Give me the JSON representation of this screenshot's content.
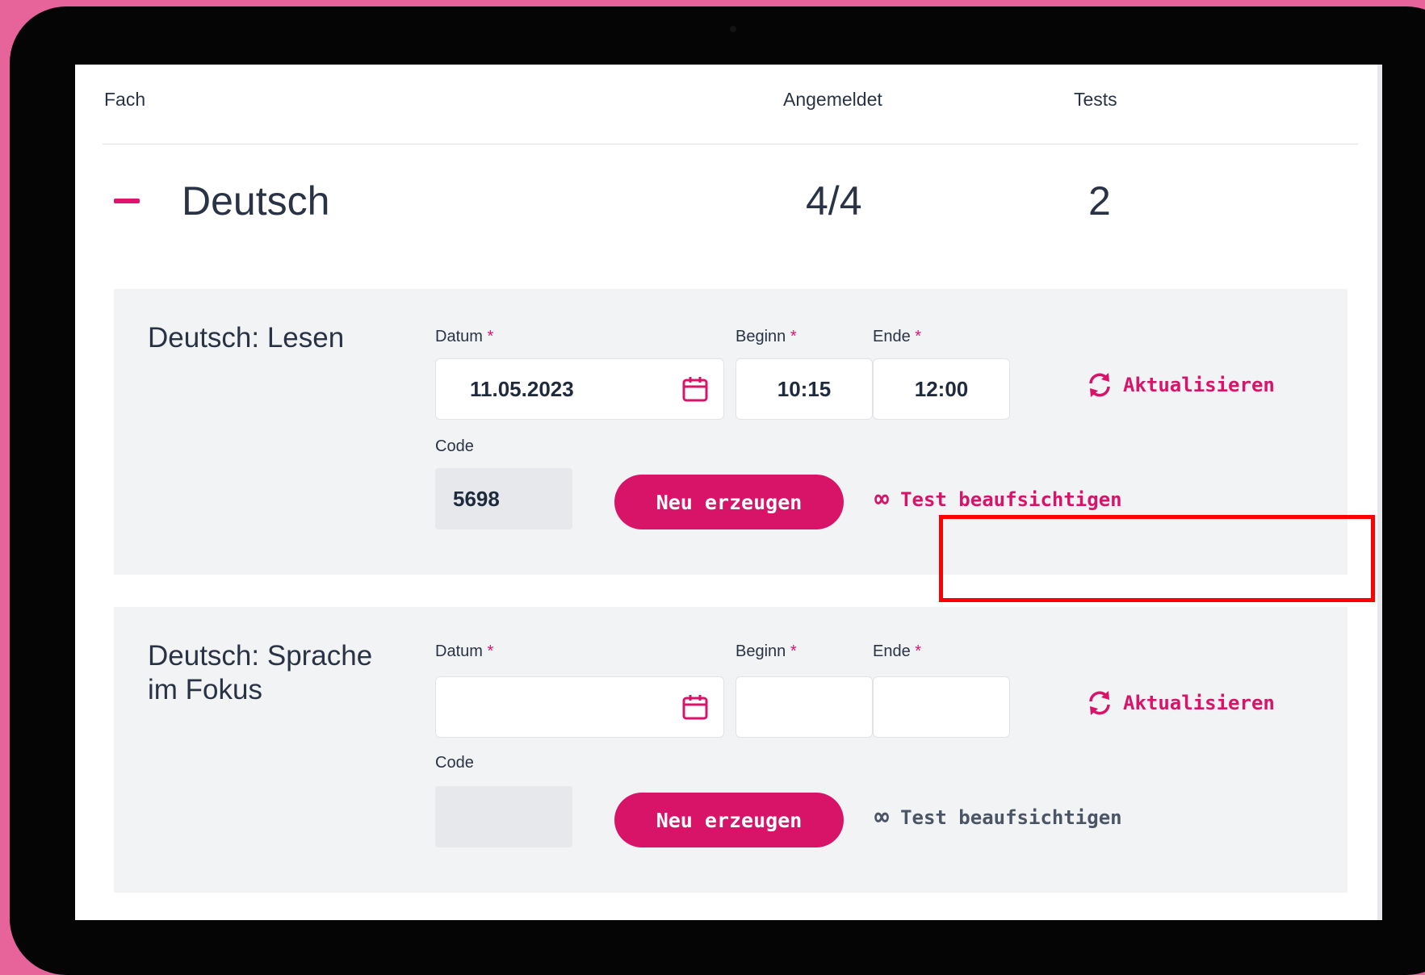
{
  "table_header": {
    "fach": "Fach",
    "angemeldet": "Angemeldet",
    "tests": "Tests"
  },
  "subject": {
    "name": "Deutsch",
    "registered": "4/4",
    "tests": "2"
  },
  "colors": {
    "accent": "#d81469",
    "background": "#e6649a",
    "highlight": "#ff0000"
  },
  "labels": {
    "datum": "Datum",
    "beginn": "Beginn",
    "ende": "Ende",
    "code": "Code",
    "required_mark": "*",
    "update": "Aktualisieren",
    "regenerate": "Neu erzeugen",
    "proctor": "Test beaufsichtigen"
  },
  "tests": [
    {
      "title": "Deutsch: Lesen",
      "date": "11.05.2023",
      "begin": "10:15",
      "end": "12:00",
      "code": "5698",
      "proctor_enabled": true,
      "highlighted": true
    },
    {
      "title": "Deutsch: Sprache im Fokus",
      "date": "",
      "begin": "",
      "end": "",
      "code": "",
      "proctor_enabled": false,
      "highlighted": false
    }
  ],
  "icons": {
    "collapse": "minus-icon",
    "calendar": "calendar-icon",
    "refresh": "refresh-icon",
    "infinity": "∞"
  }
}
